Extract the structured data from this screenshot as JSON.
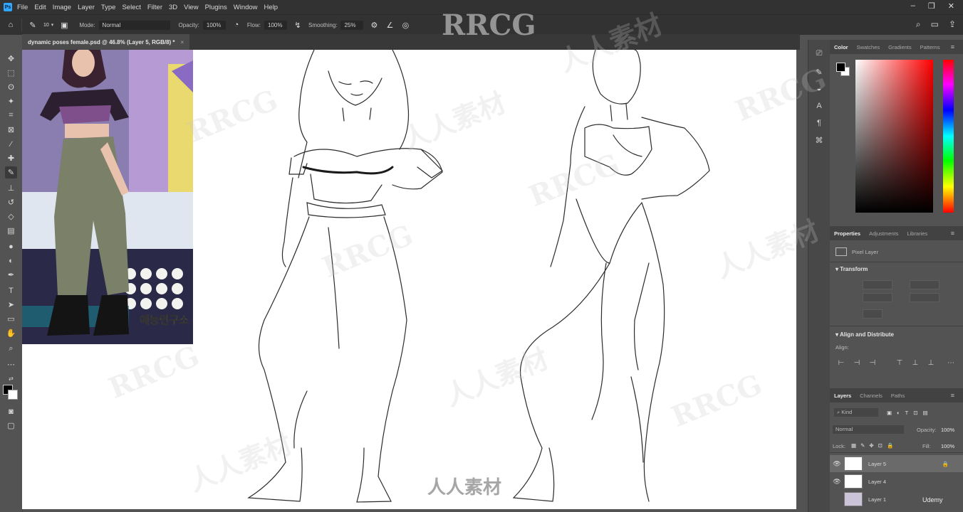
{
  "app": {
    "logo": "Ps"
  },
  "menu": [
    "File",
    "Edit",
    "Image",
    "Layer",
    "Type",
    "Select",
    "Filter",
    "3D",
    "View",
    "Plugins",
    "Window",
    "Help"
  ],
  "options": {
    "brush_size": "10",
    "mode_label": "Mode:",
    "mode_value": "Normal",
    "opacity_label": "Opacity:",
    "opacity_value": "100%",
    "flow_label": "Flow:",
    "flow_value": "100%",
    "smoothing_label": "Smoothing:",
    "smoothing_value": "25%"
  },
  "document": {
    "tab_title": "dynamic poses female.psd @ 46.8% (Layer 5, RGB/8) *",
    "close": "×"
  },
  "color_panel": {
    "tabs": [
      "Color",
      "Swatches",
      "Gradients",
      "Patterns"
    ]
  },
  "properties_panel": {
    "tabs": [
      "Properties",
      "Adjustments",
      "Libraries"
    ],
    "pixel_layer_label": "Pixel Layer",
    "transform_label": "Transform",
    "align_label": "Align and Distribute",
    "align_sub": "Align:"
  },
  "layers_panel": {
    "tabs": [
      "Layers",
      "Channels",
      "Paths"
    ],
    "kind_label": "Kind",
    "blend_mode": "Normal",
    "opacity_label": "Opacity:",
    "opacity_value": "100%",
    "lock_label": "Lock:",
    "fill_label": "Fill:",
    "fill_value": "100%",
    "layers": [
      {
        "name": "Layer 5",
        "visible": true,
        "selected": true
      },
      {
        "name": "Layer 4",
        "visible": true,
        "selected": false
      },
      {
        "name": "Layer 1",
        "visible": false,
        "selected": false
      }
    ]
  },
  "overlay": {
    "watermark_brand": "RRCG",
    "watermark_cn": "人人素材",
    "udemy": "Udemy",
    "korean_caption": "예능연구소"
  }
}
